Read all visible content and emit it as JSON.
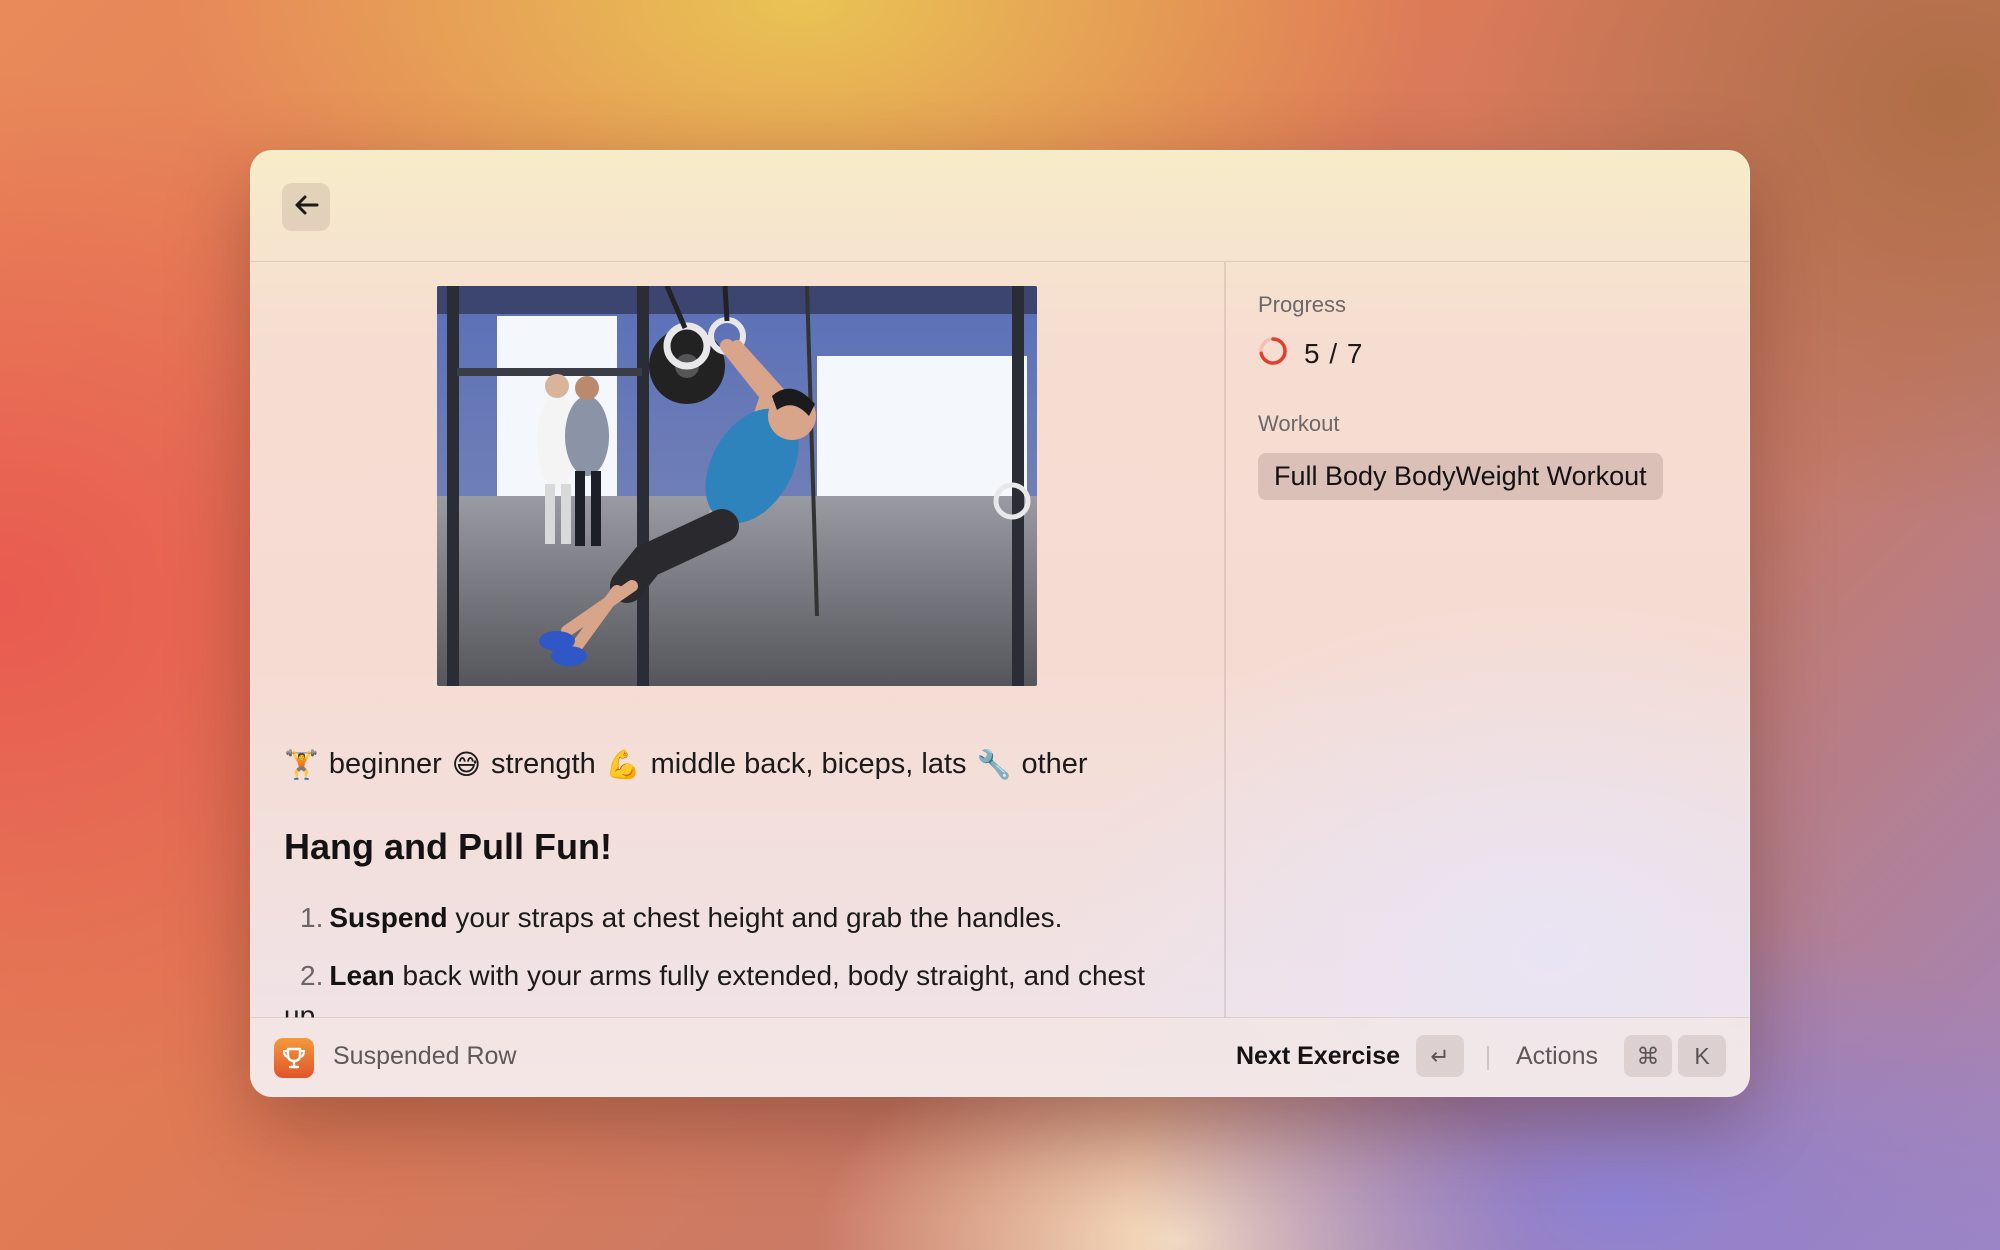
{
  "window": {
    "back_button_icon": "arrow-left-icon"
  },
  "exercise": {
    "image_alt": "Man performing a suspended row on gymnastic rings in a gym",
    "tags": [
      {
        "icon": "weightlifter-emoji",
        "emoji": "🏋️",
        "label": "beginner"
      },
      {
        "icon": "grin-sweat-emoji",
        "emoji": "😅",
        "label": "strength"
      },
      {
        "icon": "flexed-biceps-emoji",
        "emoji": "💪",
        "label": "middle back, biceps, lats"
      },
      {
        "icon": "wrench-emoji",
        "emoji": "🔧",
        "label": "other"
      }
    ],
    "heading": "Hang and Pull Fun!",
    "steps": [
      {
        "number": "1.",
        "bold": "Suspend",
        "text": " your straps at chest height and grab the handles."
      },
      {
        "number": "2.",
        "bold": "Lean",
        "text": " back with your arms fully extended, body straight, and chest up."
      }
    ]
  },
  "sidebar": {
    "progress_label": "Progress",
    "progress_text": "5 / 7",
    "progress_fraction": 0.714,
    "workout_label": "Workout",
    "workout_name": "Full Body BodyWeight Workout"
  },
  "bottombar": {
    "app_icon": "trophy-icon",
    "title": "Suspended Row",
    "primary_action": "Next Exercise",
    "primary_shortcut": "↵",
    "actions_label": "Actions",
    "actions_shortcut_modifier": "⌘",
    "actions_shortcut_key": "K"
  },
  "colors": {
    "progress_ring": "#e2402e",
    "app_icon_top": "#f29a3b",
    "app_icon_bottom": "#e2542a"
  }
}
